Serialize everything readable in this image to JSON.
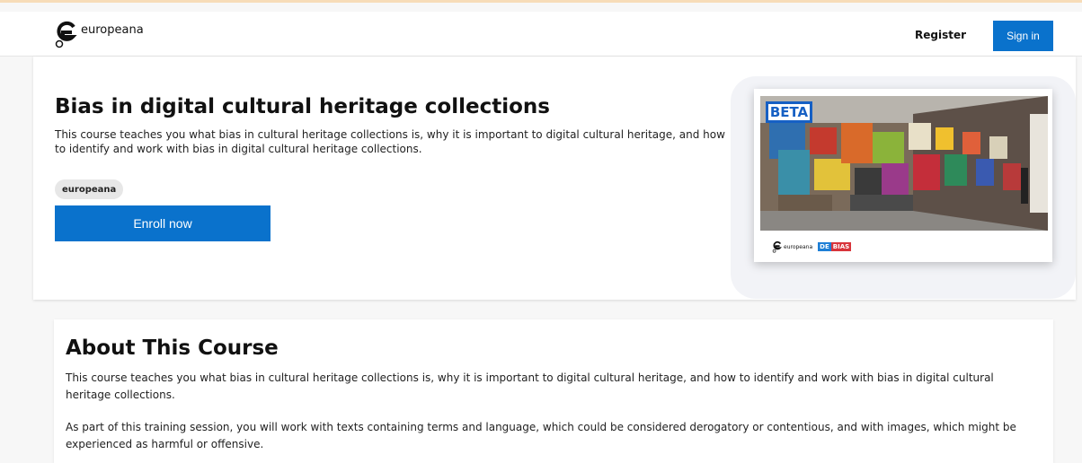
{
  "header": {
    "logo_text": "europeana",
    "register_label": "Register",
    "signin_label": "Sign in"
  },
  "course": {
    "title": "Bias in digital cultural heritage collections",
    "description": "This course teaches you what bias in cultural heritage collections is, why it is important to digital cultural heritage, and how to identify and work with bias in digital cultural heritage collections.",
    "tag": "europeana",
    "enroll_label": "Enroll now",
    "card": {
      "badge": "BETA",
      "logo_text": "europeana",
      "partner_de": "DE",
      "partner_bias": "BIAS"
    }
  },
  "about": {
    "title": "About This Course",
    "paragraphs": [
      "This course teaches you what bias in cultural heritage collections is, why it is important to digital cultural heritage, and how to identify and work with bias in digital cultural heritage collections.",
      "As part of this training session, you will work with texts containing terms and language, which could be considered derogatory or contentious, and with images, which might be experienced as harmful or offensive."
    ]
  },
  "colors": {
    "accent": "#0a72cc",
    "beta_border": "#1660c4",
    "debias_blue": "#1e7fd6",
    "debias_red": "#d8343b"
  },
  "icons": {
    "logo": "europeana-logo-icon",
    "card_image": "graffiti-wall-image"
  }
}
